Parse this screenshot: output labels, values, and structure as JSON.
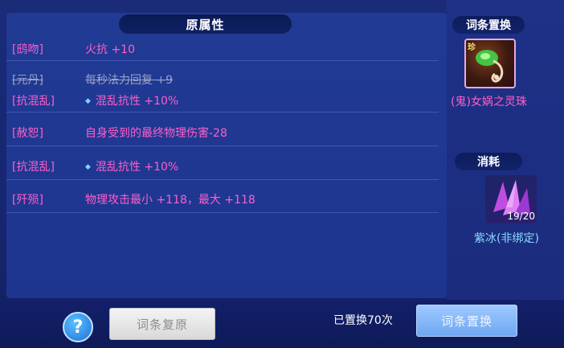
{
  "panel": {
    "title": "原属性",
    "attributes": [
      {
        "tag": "[鸱吻]",
        "value": "火抗 +10",
        "struck": false,
        "dot": false
      },
      {
        "tag": "[元丹]",
        "value": "每秒法力回复 +9",
        "struck": true,
        "dot": false
      },
      {
        "tag": "[抗混乱]",
        "value": "混乱抗性 +10%",
        "struck": false,
        "dot": true
      },
      {
        "tag": "[赦恕]",
        "value": "自身受到的最终物理伤害-28",
        "struck": false,
        "dot": false
      },
      {
        "tag": "[抗混乱]",
        "value": "混乱抗性 +10%",
        "struck": false,
        "dot": true
      },
      {
        "tag": "[歼殒]",
        "value": "物理攻击最小 +118，最大 +118",
        "struck": false,
        "dot": false
      }
    ]
  },
  "replace_section": {
    "title": "词条置换",
    "item_badge": "珍",
    "item_name": "(鬼)女娲之灵珠"
  },
  "cost_section": {
    "title": "消耗",
    "material_count": "19/20",
    "material_name": "紫冰(非绑定)"
  },
  "footer": {
    "help_label": "?",
    "restore_label": "词条复原",
    "replaced_count": "已置换70次",
    "replace_label": "词条置换"
  },
  "colors": {
    "attr_text": "#ff5fc9",
    "struck_text": "#9aa3c8",
    "accent_blue": "#7fd2ff"
  }
}
